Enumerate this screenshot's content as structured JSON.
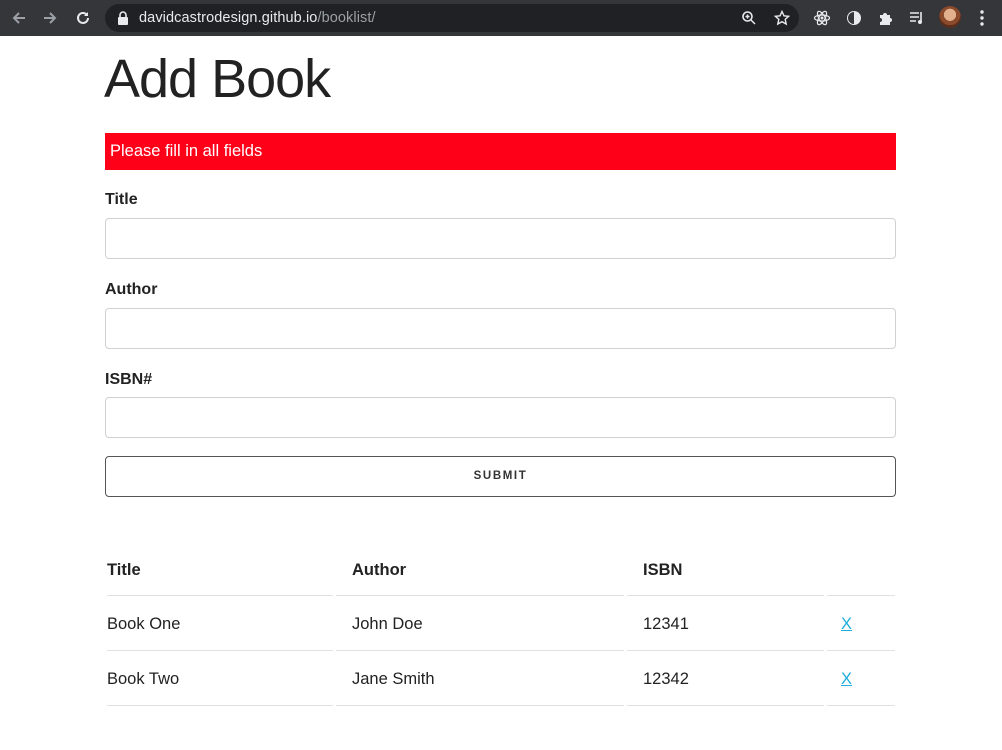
{
  "browser": {
    "url_host": "davidcastrodesign.github.io",
    "url_path": "/booklist/"
  },
  "page": {
    "heading": "Add Book",
    "alert": "Please fill in all fields"
  },
  "form": {
    "title_label": "Title",
    "title_value": "",
    "author_label": "Author",
    "author_value": "",
    "isbn_label": "ISBN#",
    "isbn_value": "",
    "submit_label": "SUBMIT"
  },
  "table": {
    "headers": [
      "Title",
      "Author",
      "ISBN"
    ],
    "rows": [
      {
        "title": "Book One",
        "author": "John Doe",
        "isbn": "12341",
        "delete": "X"
      },
      {
        "title": "Book Two",
        "author": "Jane Smith",
        "isbn": "12342",
        "delete": "X"
      }
    ]
  },
  "colors": {
    "alert_bg": "#ff0019",
    "link": "#1eaedb",
    "chrome_bg": "#35363a"
  }
}
